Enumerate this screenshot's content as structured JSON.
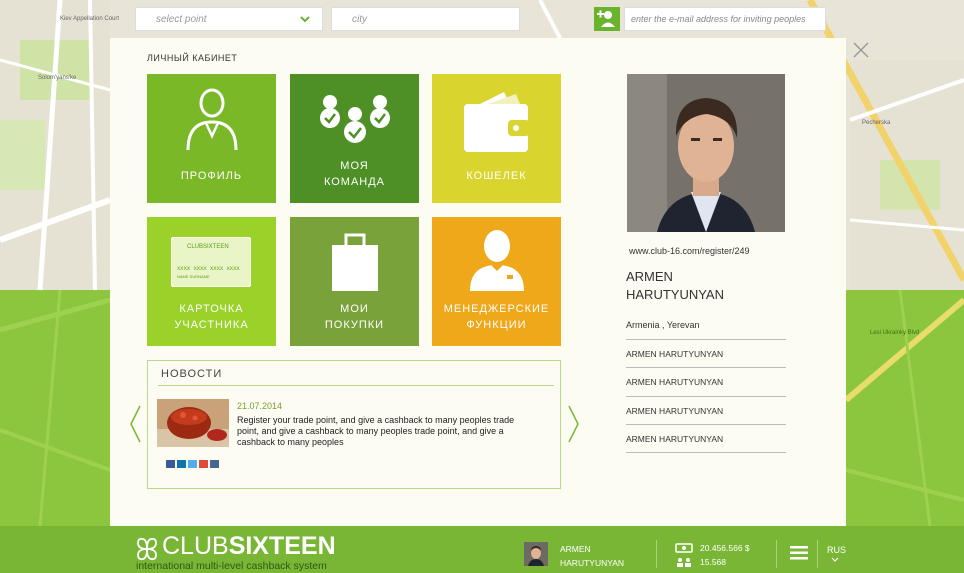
{
  "top_bar": {
    "point_select_placeholder": "select point",
    "city_placeholder": "city",
    "invite_placeholder": "enter the e-mail address for inviting peoples"
  },
  "map_labels": {
    "l1": "Kiev Appellation Court",
    "l2": "Solom'yans'ke",
    "l3": "Pecherska",
    "l4": "Lesi Ukrainky Blvd"
  },
  "modal": {
    "title": "ЛИЧНЫЙ КАБИНЕТ",
    "tiles": [
      {
        "line1": "ПРОФИЛЬ",
        "line2": "",
        "color": "#7ab827",
        "icon": "user-icon"
      },
      {
        "line1": "МОЯ",
        "line2": "КОМАНДА",
        "color": "#4e9026",
        "icon": "team-icon"
      },
      {
        "line1": "КОШЕЛЕК",
        "line2": "",
        "color": "#d9d52e",
        "icon": "wallet-icon"
      },
      {
        "line1": "КАРТОЧКА",
        "line2": "УЧАСТНИКА",
        "color": "#9ad22a",
        "icon": "card-icon"
      },
      {
        "line1": "МОИ",
        "line2": "ПОКУПКИ",
        "color": "#7aa23a",
        "icon": "shopping-bag-icon"
      },
      {
        "line1": "МЕНЕДЖЕРСКИЕ",
        "line2": "ФУНКЦИИ",
        "color": "#eea81a",
        "icon": "manager-icon"
      }
    ],
    "card": {
      "brand": "CLUBSIXTEEN",
      "number": "XXXX XXXX XXXX XXXX",
      "holder": "NAME SURNAME"
    },
    "news": {
      "title": "НОВОСТИ",
      "date": "21.07.2014",
      "text": "Register your trade point, and give a cashback to many peoples trade point, and give a cashback to many peoples trade point, and give a cashback to many peoples"
    },
    "profile": {
      "ref_link": "www.club-16.com/register/249",
      "name_line1": "ARMEN",
      "name_line2": "HARUTYUNYAN",
      "location": "Armenia , Yerevan",
      "items": [
        "ARMEN HARUTYUNYAN",
        "ARMEN HARUTYUNYAN",
        "ARMEN HARUTYUNYAN",
        "ARMEN HARUTYUNYAN"
      ]
    }
  },
  "footer": {
    "logo_club": "CLUB",
    "logo_sixteen": "SIXTEEN",
    "tagline": "international multi-level cashback system",
    "user_line1": "ARMEN",
    "user_line2": "HARUTYUNYAN",
    "balance": "20.456.566 $",
    "team_count": "15.568",
    "language": "RUS"
  },
  "colors": {
    "accent": "#7ab635",
    "map_green": "#8cc63f",
    "modal_bg": "#fcfcf2"
  }
}
